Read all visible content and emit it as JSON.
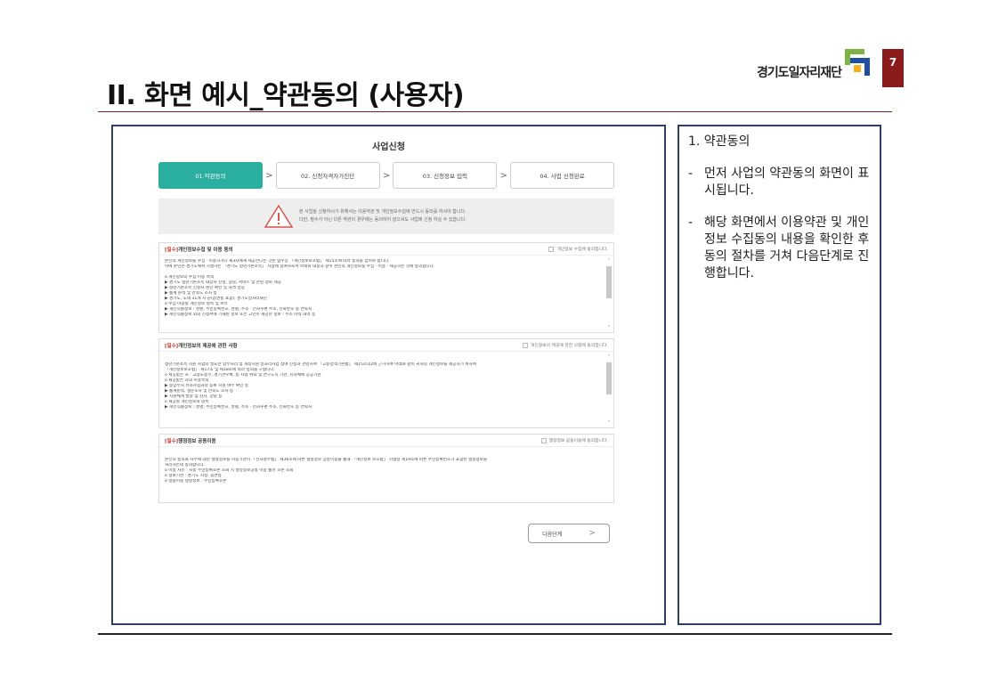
{
  "slide": {
    "title": "II. 화면 예시_약관동의 (사용자)",
    "page_number": "7",
    "logo_text": "경기도일자리재단"
  },
  "app": {
    "title": "사업신청",
    "steps": [
      {
        "label": "01.약관동의",
        "active": true
      },
      {
        "label": "02. 신청자격자가진단",
        "active": false
      },
      {
        "label": "03. 신청정보 입력",
        "active": false
      },
      {
        "label": "04. 사업 신청완료",
        "active": false
      }
    ],
    "step_separator": ">",
    "notice": {
      "line1": "본 사업을 신청하시기 위해서는 이용약관 및 개인정보수집에 반드시 동의를 하셔야 합니다.",
      "line2": "다만, 필수가 아닌 다른 약관의 경우에는 동의하지 않으셔도 사업에 신청 하실 수 있습니다."
    },
    "terms": [
      {
        "required_tag": "[필수]",
        "title": "개인정보수집 및 이용 동의",
        "agree_label": "개인정보 수집에 동의합니다.",
        "lines": [
          "본인의 개인정보를 수집 · 이용하거나 제3자에게 제공한다는 것은 업무상 「개인정보보호법」 제15조에 따라 동의를 얻어야 합니다.",
          "이에 본인은 경기도에서 시행하는 「경기도 청년기본소득」 사업에 참여자로서 아래와 내용과 같이 본인의 개인정보를 수집 · 이용 · 제공하는 것에 동의합니다.",
          "",
          "o 개인정보의 수집·이용 목적",
          "  ▶ 경기도 청년기본소득 대상자 선정, 상담, 서비스 및 관련 정보 제공",
          "  ▶ 청년기본소득 신청자 본인 확인 및 자격 검증",
          "  ▶ 통계 분석 및 만족도 조사 등",
          "  ▶ 경기도, 도내 31개 시·군(읍면동 포함), 경기도일자리재단",
          "o 수집·이용할 개인정보 항목 및 보유",
          "  ▶ 개인식별정보 : 성명, 주민등록번호, 성별, 주소 · 전자우편 주소, 전화번호 등 연락처",
          "  ▶ 개인식별정보 외의 신청서에 기재된 정보 또는 고인이 제공한 정보 : 주소 이력 내역 등"
        ]
      },
      {
        "required_tag": "[필수]",
        "title": "개인정보의 제공에 관한 사항",
        "agree_label": "개인정보의 제공에 관한 사항에 동의합니다.",
        "lines": [
          "청년기본소득 지원 사업의 필요한 업무처리 및 개정지원 일자리사업 참여 신청과 관련하여 「고용정책기본법」 제15조의2에 근거하여 아래와 같이 귀하의 개인정보를 제공하기 위하여",
          "「개인정보보호법」 제17조 및 제18조에 따라 동의를 구합니다.",
          "o 제공받는 자 : 고용노동부, 경기관우체, 등 사업 위탁 및 연구도시 기관, 지자체에 공공기관",
          "o 제공받는 자의 이용목적",
          "  ▶ 중앙부처 유사사업과의 중복 지원 여부 확인 등",
          "  ▶ 통계분석, 설문조사 및 만족도 조사 등",
          "  ▶ 지원체계 발굴 및 감사, 상담 등",
          "o 제공할 개인정보의 항목",
          "  ▶ 개인식별정보 : 성명, 주민등록번호, 성별, 주소 · 전자우편 주소, 전화번호 등 연락처"
        ]
      },
      {
        "required_tag": "[필수]",
        "title": "행정정보 공동이용",
        "agree_label": "행정정보 공동이용에 동의합니다.",
        "lines": [
          "본인의 동의와 사무에 대한 행정정보를 이용기관이 「전자정부법」 제36조에 따른 행정정보 공동이용을 통해 「개인정보 보호법」 시행령 제19조에 따른 주민등록번호가 포함된 행정정보를",
          "처리하는데 동의합니다.",
          "o 이용 사유 : 자동 주민등록초본 조회 시 행정정보공동 이용 통한 초본 조회",
          "o 정보기관 : 경기도 시청, 읍면동",
          "o 열람이용 행정정보 : 주민등록초본"
        ]
      }
    ],
    "next_button": "다음단계",
    "next_chevron": ">"
  },
  "explanation": {
    "heading": "1.  약관동의",
    "items": [
      {
        "bullet": "-",
        "text": "먼저 사업의 약관동의 화면이 표시됩니다."
      },
      {
        "bullet": "-",
        "text": "해당 화면에서 이용약관 및 개인정보 수집동의 내용을 확인한 후 동의 절차를 거쳐 다음단계로 진행합니다."
      }
    ]
  },
  "colors": {
    "step_active": "#2aae9e",
    "panel_border": "#2c3e66",
    "page_badge": "#8b1a1a",
    "required": "#c0392b"
  },
  "icons": [
    "warning-icon",
    "checkbox-icon",
    "chevron-right-icon",
    "scroll-up-icon",
    "scroll-down-icon",
    "logo-mark"
  ]
}
